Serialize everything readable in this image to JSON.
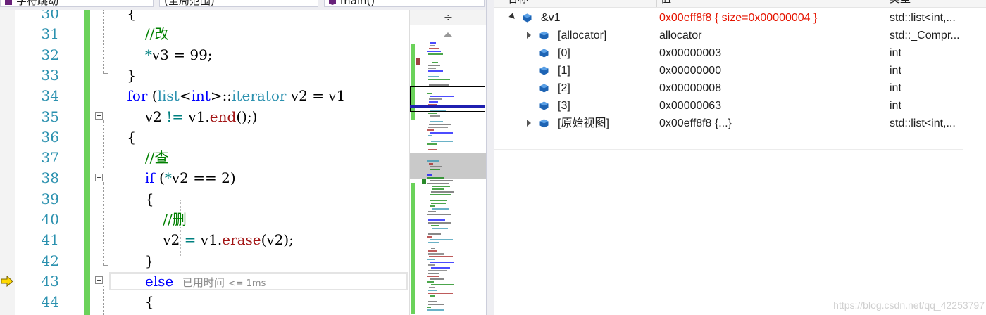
{
  "nav": {
    "project": "字符跳动",
    "scope": "(全局范围)",
    "member": "main()"
  },
  "editor": {
    "lines": [
      {
        "num": "30",
        "segments": [
          {
            "t": "    {",
            "c": ""
          }
        ]
      },
      {
        "num": "31",
        "segments": [
          {
            "t": "        //改",
            "c": "cm"
          }
        ]
      },
      {
        "num": "32",
        "segments": [
          {
            "t": "        ",
            "c": ""
          },
          {
            "t": "*",
            "c": "op"
          },
          {
            "t": "v3 = 99;",
            "c": ""
          }
        ]
      },
      {
        "num": "33",
        "segments": [
          {
            "t": "    }",
            "c": ""
          }
        ]
      },
      {
        "num": "34",
        "segments": [
          {
            "t": "    ",
            "c": ""
          },
          {
            "t": "for",
            "c": "kw"
          },
          {
            "t": " (",
            "c": ""
          },
          {
            "t": "list",
            "c": "ty"
          },
          {
            "t": "<",
            "c": ""
          },
          {
            "t": "int",
            "c": "kw"
          },
          {
            "t": ">::",
            "c": ""
          },
          {
            "t": "iterator",
            "c": "ty"
          },
          {
            "t": " v2 = v1",
            "c": ""
          }
        ]
      },
      {
        "num": "35",
        "segments": [
          {
            "t": "        v2 ",
            "c": ""
          },
          {
            "t": "!=",
            "c": "op"
          },
          {
            "t": " v1.",
            "c": ""
          },
          {
            "t": "end",
            "c": "erase"
          },
          {
            "t": "();)",
            "c": ""
          }
        ]
      },
      {
        "num": "36",
        "segments": [
          {
            "t": "    {",
            "c": ""
          }
        ]
      },
      {
        "num": "37",
        "segments": [
          {
            "t": "        //查",
            "c": "cm"
          }
        ]
      },
      {
        "num": "38",
        "segments": [
          {
            "t": "        ",
            "c": ""
          },
          {
            "t": "if",
            "c": "kw"
          },
          {
            "t": " (",
            "c": ""
          },
          {
            "t": "*",
            "c": "op"
          },
          {
            "t": "v2 == 2)",
            "c": ""
          }
        ]
      },
      {
        "num": "39",
        "segments": [
          {
            "t": "        {",
            "c": ""
          }
        ]
      },
      {
        "num": "40",
        "segments": [
          {
            "t": "            //删",
            "c": "cm"
          }
        ]
      },
      {
        "num": "41",
        "segments": [
          {
            "t": "            v2 ",
            "c": ""
          },
          {
            "t": "=",
            "c": "op"
          },
          {
            "t": " v1.",
            "c": ""
          },
          {
            "t": "erase",
            "c": "erase"
          },
          {
            "t": "(v2);",
            "c": ""
          }
        ]
      },
      {
        "num": "42",
        "segments": [
          {
            "t": "        }",
            "c": ""
          }
        ]
      },
      {
        "num": "43",
        "segments": [
          {
            "t": "        ",
            "c": ""
          },
          {
            "t": "else",
            "c": "kw"
          }
        ]
      },
      {
        "num": "44",
        "segments": [
          {
            "t": "        {",
            "c": ""
          }
        ]
      }
    ],
    "timing_label": "已用时间",
    "timing_value": "<= 1ms"
  },
  "scrollmap": {
    "split_glyph": "÷"
  },
  "watch": {
    "columns": {
      "name": "名称",
      "value": "值",
      "type": "类型"
    },
    "rows": [
      {
        "name": "&v1",
        "value": "0x00eff8f8 { size=0x00000004 }",
        "type": "std::list<int,...",
        "value_red": true
      },
      {
        "name": "[allocator]",
        "value": "allocator",
        "type": "std::_Compr..."
      },
      {
        "name": "[0]",
        "value": "0x00000003",
        "type": "int"
      },
      {
        "name": "[1]",
        "value": "0x00000000",
        "type": "int"
      },
      {
        "name": "[2]",
        "value": "0x00000008",
        "type": "int"
      },
      {
        "name": "[3]",
        "value": "0x00000063",
        "type": "int"
      },
      {
        "name": "[原始视图]",
        "value": "0x00eff8f8 {...}",
        "type": "std::list<int,..."
      }
    ]
  },
  "watermark": "https://blog.csdn.net/qq_42253797",
  "colors": {
    "keyword": "#0000ff",
    "type": "#2b91af",
    "comment": "#008000",
    "line_number": "#2b91af",
    "changed_value": "#e51400",
    "change_bar": "#6bd25a"
  }
}
